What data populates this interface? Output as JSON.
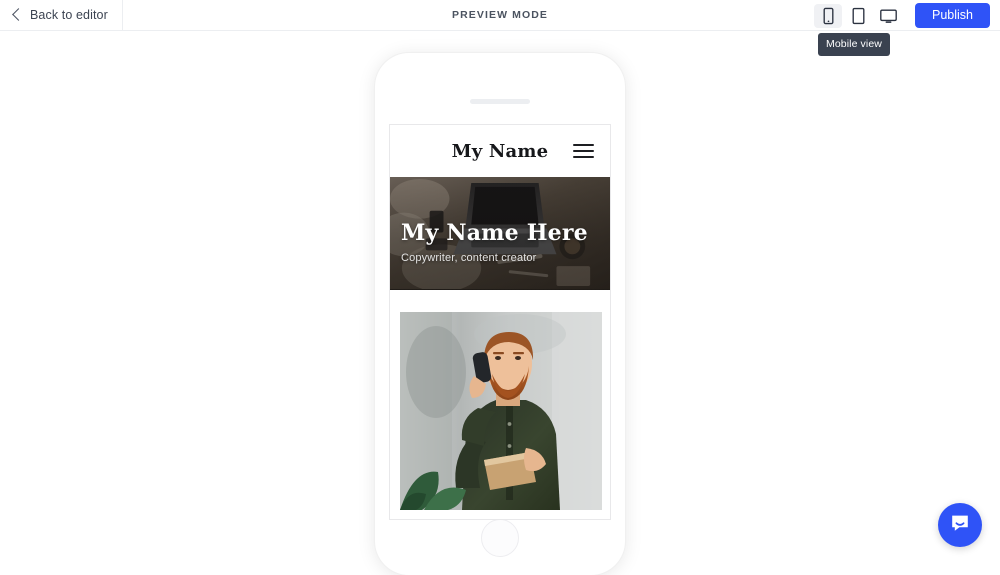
{
  "topbar": {
    "back_label": "Back to editor",
    "back_icon": "chevron-left-icon",
    "preview_mode_label": "PREVIEW MODE",
    "publish_label": "Publish",
    "publish_color": "#2f53f7",
    "devices": [
      {
        "name": "mobile",
        "icon": "mobile-phone-icon",
        "label": "Mobile view",
        "active": true
      },
      {
        "name": "tablet",
        "icon": "tablet-icon",
        "label": "Tablet view",
        "active": false
      },
      {
        "name": "desktop",
        "icon": "desktop-monitor-icon",
        "label": "Desktop view",
        "active": false
      }
    ],
    "tooltip": "Mobile view"
  },
  "device_preview": {
    "device": "mobile",
    "speaker_icon": "phone-speaker-slit",
    "home_button_icon": "phone-home-button"
  },
  "site": {
    "nav": {
      "brand": "My Name",
      "menu_icon": "hamburger-menu-icon"
    },
    "hero": {
      "title": "My Name Here",
      "subtitle": "Copywriter, content creator",
      "background_image": "desk-with-laptop-overhead-photo",
      "overlay_color": "rgba(18,14,10,0.46)"
    },
    "portrait": {
      "image": "bearded-man-on-phone-holding-book-photo"
    }
  },
  "support": {
    "launcher_icon": "intercom-chat-bubble-icon",
    "launcher_color": "#2f53f7"
  }
}
